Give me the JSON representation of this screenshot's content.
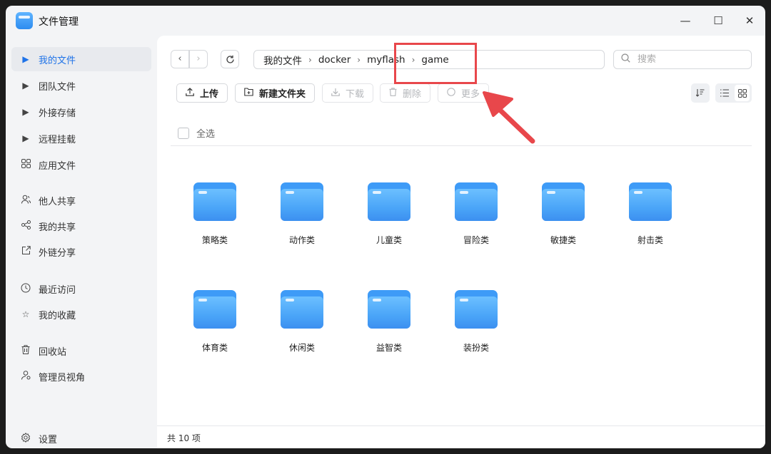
{
  "app": {
    "title": "文件管理",
    "controls": {
      "minimize": "—",
      "maximize": "☐",
      "close": "✕"
    }
  },
  "sidebar": {
    "items": [
      {
        "label": "我的文件",
        "icon": "triangle-right-icon",
        "active": true
      },
      {
        "label": "团队文件",
        "icon": "triangle-right-icon"
      },
      {
        "label": "外接存储",
        "icon": "triangle-right-icon"
      },
      {
        "label": "远程挂载",
        "icon": "triangle-right-icon"
      },
      {
        "label": "应用文件",
        "icon": "grid-icon"
      },
      {
        "label": "他人共享",
        "icon": "user-icon"
      },
      {
        "label": "我的共享",
        "icon": "share-icon"
      },
      {
        "label": "外链分享",
        "icon": "external-link-icon"
      },
      {
        "label": "最近访问",
        "icon": "clock-icon"
      },
      {
        "label": "我的收藏",
        "icon": "star-icon"
      },
      {
        "label": "回收站",
        "icon": "trash-icon"
      },
      {
        "label": "管理员视角",
        "icon": "admin-icon"
      }
    ],
    "settings": {
      "label": "设置",
      "icon": "gear-icon"
    }
  },
  "breadcrumb": [
    "我的文件",
    "docker",
    "myflash",
    "game"
  ],
  "search": {
    "placeholder": "搜索"
  },
  "toolbar": {
    "upload": "上传",
    "new_folder": "新建文件夹",
    "download": "下载",
    "delete": "删除",
    "more": "更多"
  },
  "select_all": "全选",
  "folders": [
    "策略类",
    "动作类",
    "儿童类",
    "冒险类",
    "敏捷类",
    "射击类",
    "体育类",
    "休闲类",
    "益智类",
    "装扮类"
  ],
  "footer": {
    "count": "共 10 项"
  },
  "colors": {
    "accent": "#1f73e8",
    "annotation": "#e8474b",
    "folder": "#4aa5f8"
  }
}
